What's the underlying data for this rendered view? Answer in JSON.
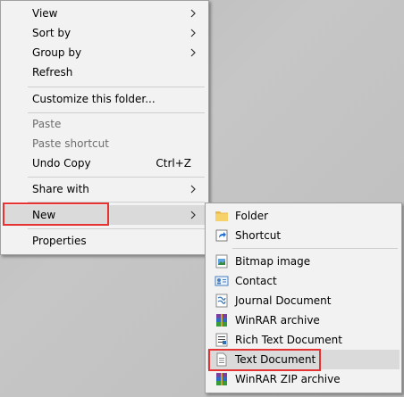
{
  "context_menu": {
    "view_label": "View",
    "sort_by_label": "Sort by",
    "group_by_label": "Group by",
    "refresh_label": "Refresh",
    "customize_label": "Customize this folder...",
    "paste_label": "Paste",
    "paste_shortcut_label": "Paste shortcut",
    "undo_copy_label": "Undo Copy",
    "undo_copy_shortcut": "Ctrl+Z",
    "share_with_label": "Share with",
    "new_label": "New",
    "properties_label": "Properties"
  },
  "new_submenu": {
    "items": [
      {
        "label": "Folder",
        "icon": "folder-icon"
      },
      {
        "label": "Shortcut",
        "icon": "shortcut-icon"
      },
      {
        "label": "Bitmap image",
        "icon": "bitmap-icon"
      },
      {
        "label": "Contact",
        "icon": "contact-card-icon"
      },
      {
        "label": "Journal Document",
        "icon": "journal-icon"
      },
      {
        "label": "WinRAR archive",
        "icon": "winrar-icon"
      },
      {
        "label": "Rich Text Document",
        "icon": "rich-text-icon"
      },
      {
        "label": "Text Document",
        "icon": "text-document-icon"
      },
      {
        "label": "WinRAR ZIP archive",
        "icon": "winrar-zip-icon"
      }
    ]
  },
  "colors": {
    "menu_bg": "#f2f2f2",
    "hover_bg": "#dadada",
    "annotation_red": "#e53232",
    "disabled_text": "#6d6d6d"
  }
}
